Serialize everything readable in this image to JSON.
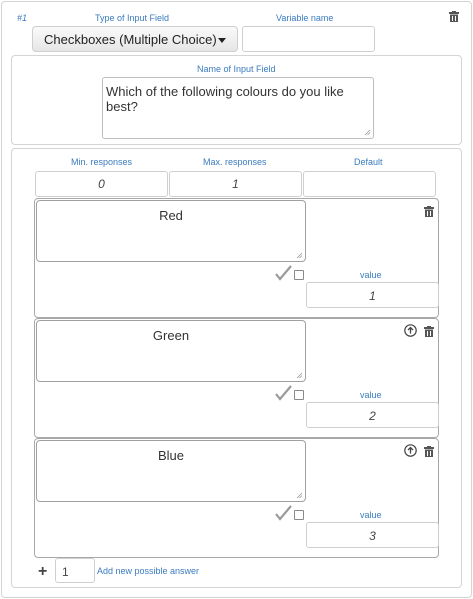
{
  "item_number": "#1",
  "header": {
    "type_label": "Type of Input Field",
    "type_value": "Checkboxes (Multiple Choice)",
    "variable_label": "Variable name",
    "variable_value": ""
  },
  "name_section": {
    "label": "Name of Input Field",
    "value": "Which of the following colours do you like best?"
  },
  "responses": {
    "min_label": "Min. responses",
    "min_value": "0",
    "max_label": "Max. responses",
    "max_value": "1",
    "default_label": "Default",
    "default_value": ""
  },
  "answers": [
    {
      "text": "Red",
      "value_label": "value",
      "value": "1",
      "checked": false
    },
    {
      "text": "Green",
      "value_label": "value",
      "value": "2",
      "checked": false
    },
    {
      "text": "Blue",
      "value_label": "value",
      "value": "3",
      "checked": false
    }
  ],
  "add": {
    "plus": "+",
    "count": "1",
    "label": "Add new possible answer"
  },
  "icons": {
    "trash": "trash-icon",
    "move_up": "arrow-up-circle-icon",
    "check": "checkmark-icon"
  },
  "colors": {
    "label_blue": "#3a7bbf"
  }
}
